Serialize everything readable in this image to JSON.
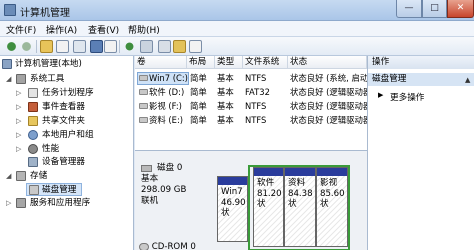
{
  "window": {
    "title": "计算机管理",
    "min_glyph": "—",
    "max_glyph": "□",
    "close_glyph": "✕"
  },
  "menu": [
    "文件(F)",
    "操作(A)",
    "查看(V)",
    "帮助(H)"
  ],
  "toolbar_icons": [
    "back-icon",
    "forward-icon",
    "folder-up-icon",
    "show-tree-icon",
    "help-icon",
    "properties-icon",
    "refresh-icon",
    "delete-icon",
    "check-icon",
    "export-icon",
    "search-icon",
    "view-icon"
  ],
  "tree": {
    "root": "计算机管理(本地)",
    "system_tools": "系统工具",
    "task_scheduler": "任务计划程序",
    "event_viewer": "事件查看器",
    "shared_folders": "共享文件夹",
    "local_users": "本地用户和组",
    "performance": "性能",
    "device_manager": "设备管理器",
    "storage": "存储",
    "disk_management": "磁盘管理",
    "services_apps": "服务和应用程序"
  },
  "volume_list": {
    "headers": [
      "卷",
      "布局",
      "类型",
      "文件系统",
      "状态"
    ],
    "rows": [
      [
        "Win7 (C:)",
        "简单",
        "基本",
        "NTFS",
        "状态良好 (系统, 启动..."
      ],
      [
        "软件 (D:)",
        "简单",
        "基本",
        "FAT32",
        "状态良好 (逻辑驱动器)"
      ],
      [
        "影视 (F:)",
        "简单",
        "基本",
        "NTFS",
        "状态良好 (逻辑驱动器)"
      ],
      [
        "资料 (E:)",
        "简单",
        "基本",
        "NTFS",
        "状态良好 (逻辑驱动器)"
      ]
    ]
  },
  "disk0": {
    "name": "磁盘 0",
    "type": "基本",
    "size": "298.09 GB",
    "status": "联机",
    "partitions": [
      {
        "name": "Win7",
        "size": "46.90"
      },
      {
        "name": "软件",
        "size": "81.20"
      },
      {
        "name": "资料",
        "size": "84.38"
      },
      {
        "name": "影视",
        "size": "85.60"
      }
    ],
    "partition_status": [
      "状",
      "状",
      "状",
      "状"
    ]
  },
  "cdrom": "CD-ROM 0",
  "actions": {
    "header": "操作",
    "section": "磁盘管理",
    "more": "更多操作"
  },
  "colors": {
    "partition_cap": "#2a3c9c",
    "extended_border": "#3a9b3a",
    "selection": "#d5e5f8"
  }
}
